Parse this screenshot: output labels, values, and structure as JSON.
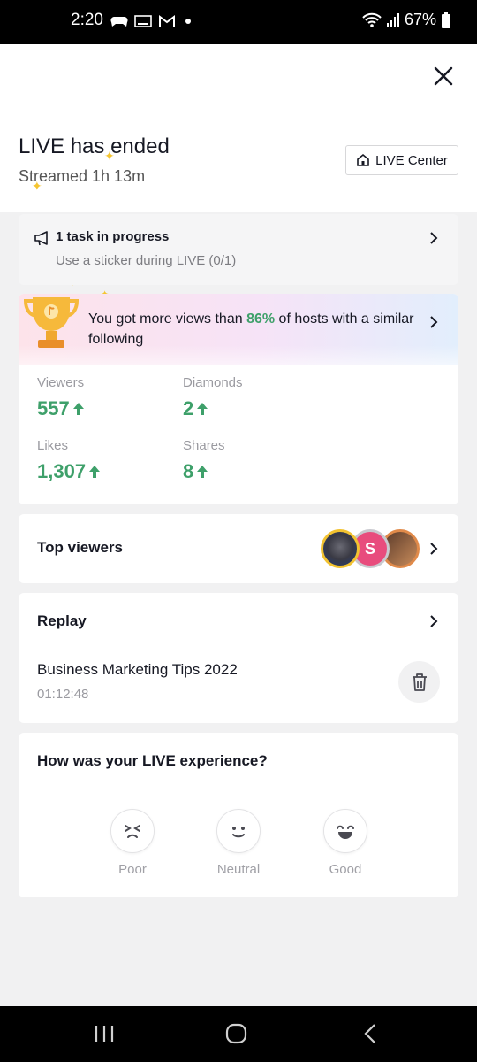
{
  "status_bar": {
    "time": "2:20",
    "battery": "67%"
  },
  "header": {
    "title": "LIVE has ended",
    "subtitle": "Streamed 1h 13m",
    "live_center_label": "LIVE Center"
  },
  "task": {
    "title": "1 task in progress",
    "subtitle": "Use a sticker during LIVE (0/1)"
  },
  "banner": {
    "text_before": "You got more views than ",
    "percent": "86%",
    "text_after": " of hosts with a similar following"
  },
  "stats": [
    {
      "label": "Viewers",
      "value": "557"
    },
    {
      "label": "Diamonds",
      "value": "2"
    },
    {
      "label": "Likes",
      "value": "1,307"
    },
    {
      "label": "Shares",
      "value": "8"
    }
  ],
  "top_viewers": {
    "title": "Top viewers",
    "avatar_letter": "S"
  },
  "replay": {
    "title": "Replay",
    "name": "Business Marketing Tips 2022",
    "duration": "01:12:48"
  },
  "experience": {
    "question": "How was your LIVE experience?",
    "options": [
      {
        "label": "Poor",
        "icon": "poor-face-icon"
      },
      {
        "label": "Neutral",
        "icon": "neutral-face-icon"
      },
      {
        "label": "Good",
        "icon": "good-face-icon"
      }
    ]
  },
  "colors": {
    "positive": "#3ea06a",
    "accent_orange": "#f5c531"
  }
}
